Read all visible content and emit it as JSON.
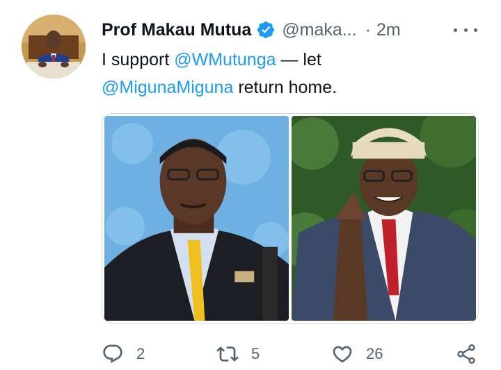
{
  "author": {
    "name": "Prof Makau Mutua",
    "handle": "@maka...",
    "separator": "·",
    "time": "2m",
    "avatar_icon": "profile-photo",
    "verified_icon": "verified-badge-icon"
  },
  "tweet": {
    "text_before": "I support ",
    "mention_1": "@WMutunga",
    "text_middle": " — let ",
    "mention_2": "@MigunaMiguna",
    "text_after": " return home."
  },
  "media": {
    "photo_1": "photo of man in suit with yellow tie at microphone",
    "photo_2": "photo of man in white hat with hands pressed together"
  },
  "actions": {
    "reply_count": "2",
    "retweet_count": "5",
    "like_count": "26"
  },
  "colors": {
    "accent": "#1d9bf0",
    "secondary_text": "#536471",
    "primary_text": "#0f1419",
    "border": "#cfd9de"
  }
}
